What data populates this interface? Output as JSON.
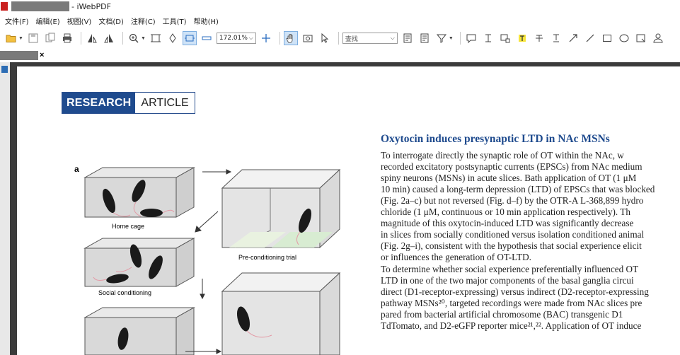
{
  "window": {
    "title": "- iWebPDF"
  },
  "menu": [
    "文件(F)",
    "编辑(E)",
    "视图(V)",
    "文档(D)",
    "注释(C)",
    "工具(T)",
    "帮助(H)"
  ],
  "toolbar": {
    "zoom": "172.01%",
    "search_placeholder": "查找"
  },
  "tab": {
    "close": "×"
  },
  "article": {
    "badge_research": "RESEARCH",
    "badge_article": "ARTICLE",
    "figure": {
      "panel_label": "a",
      "captions": [
        "Home cage",
        "Pre-conditioning trial",
        "Social conditioning"
      ]
    },
    "heading": "Oxytocin induces presynaptic LTD in NAc MSNs",
    "lines": [
      "To interrogate directly the synaptic role of OT within the NAc, w",
      "recorded excitatory postsynaptic currents (EPSCs) from NAc medium",
      "spiny neurons (MSNs) in acute slices. Bath application of OT (1 μM",
      "10 min) caused a long-term depression (LTD) of EPSCs that was blocked",
      "(Fig. 2a–c) but not reversed (Fig. d–f) by the OTR-A L-368,899 hydro",
      "chloride (1 μM, continuous or 10 min application respectively). Th",
      "magnitude of this oxytocin-induced LTD was significantly decrease",
      "in slices from socially conditioned versus isolation conditioned animal",
      "(Fig. 2g–i), consistent with the hypothesis that social experience elicit",
      "or influences the generation of OT-LTD.",
      "   To determine whether social experience preferentially influenced OT",
      "LTD in one of the two major components of the basal ganglia circui",
      "direct (D1-receptor-expressing) versus indirect (D2-receptor-expressing",
      "pathway MSNs²⁰, targeted recordings were made from NAc slices pre",
      "pared from bacterial artificial chromosome (BAC) transgenic D1",
      "TdTomato, and D2-eGFP reporter mice²¹,²². Application of OT induce"
    ]
  }
}
